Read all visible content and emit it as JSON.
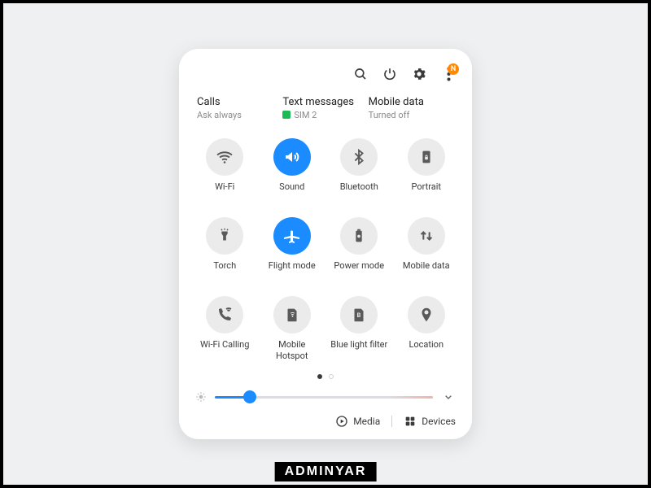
{
  "topbar": {
    "search_icon": "search",
    "power_icon": "power",
    "settings_icon": "settings",
    "more_icon": "more",
    "badge_letter": "N"
  },
  "sim": {
    "calls": {
      "title": "Calls",
      "sub": "Ask always"
    },
    "texts": {
      "title": "Text messages",
      "sub": "SIM 2"
    },
    "data": {
      "title": "Mobile data",
      "sub": "Turned off"
    }
  },
  "toggle_labels": {
    "wifi": "Wi-Fi",
    "sound": "Sound",
    "bluetooth": "Bluetooth",
    "portrait": "Portrait",
    "torch": "Torch",
    "flightmode": "Flight mode",
    "powermode": "Power mode",
    "mobiledata": "Mobile data",
    "wificalling": "Wi-Fi Calling",
    "mobilehotspot": "Mobile Hotspot",
    "bluelight": "Blue light filter",
    "location": "Location"
  },
  "toggle_state": {
    "sound_active": true,
    "flightmode_active": true
  },
  "brightness": {
    "percent": 16
  },
  "bottom": {
    "media": "Media",
    "devices": "Devices"
  },
  "watermark": "ADMINYAR"
}
